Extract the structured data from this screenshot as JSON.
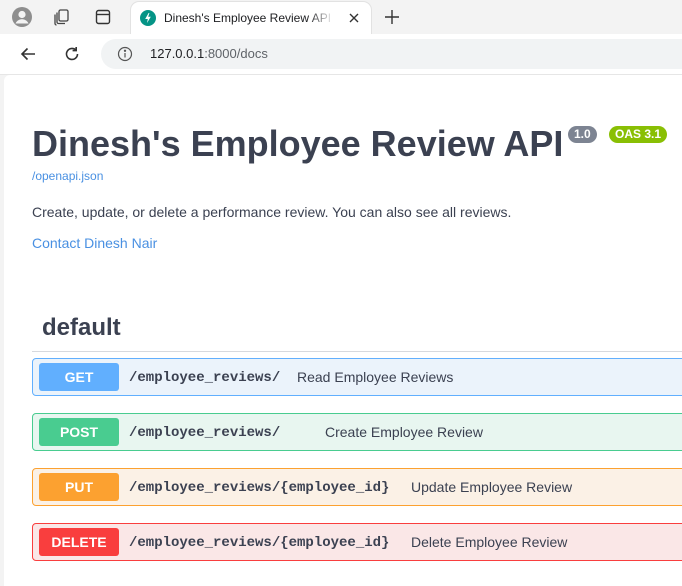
{
  "browser": {
    "tab": {
      "title": "Dinesh's Employee Review API - Swagger UI"
    },
    "address": {
      "host": "127.0.0.1",
      "path": ":8000/docs"
    },
    "icons": [
      "profile-icon",
      "workspaces-icon",
      "tab-actions-icon",
      "fastapi-favicon-icon",
      "close-icon",
      "plus-icon",
      "back-arrow-icon",
      "reload-icon",
      "info-icon"
    ]
  },
  "api": {
    "title": "Dinesh's Employee Review API",
    "version": "1.0",
    "oas": "OAS 3.1",
    "spec_link": "/openapi.json",
    "description": "Create, update, or delete a performance review. You can also see all reviews.",
    "contact": "Contact Dinesh Nair"
  },
  "section": {
    "title": "default",
    "operations": [
      {
        "method": "GET",
        "path": "/employee_reviews/",
        "summary": "Read Employee Reviews",
        "color": "#61affe"
      },
      {
        "method": "POST",
        "path": "/employee_reviews/",
        "summary": "Create Employee Review",
        "color": "#49cc90"
      },
      {
        "method": "PUT",
        "path": "/employee_reviews/{employee_id}",
        "summary": "Update Employee Review",
        "color": "#fca130"
      },
      {
        "method": "DELETE",
        "path": "/employee_reviews/{employee_id}",
        "summary": "Delete Employee Review",
        "color": "#f93e3e"
      }
    ]
  }
}
